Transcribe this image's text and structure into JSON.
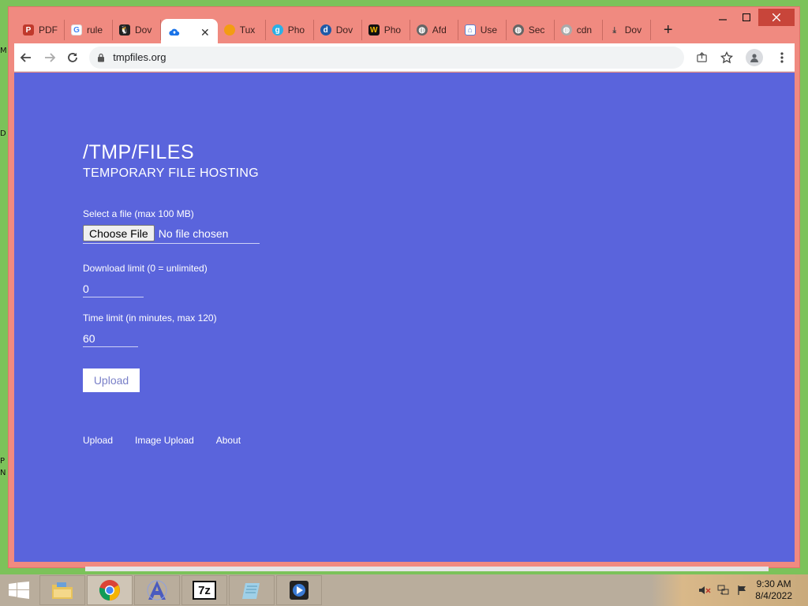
{
  "desktop": {
    "edge_letters": [
      "M",
      "D",
      "P",
      "N"
    ]
  },
  "browser": {
    "tabs": [
      {
        "label": "PDF",
        "icon": "pdf-icon",
        "color": "#c0392b"
      },
      {
        "label": "rule",
        "icon": "google-icon",
        "color": "#4285f4"
      },
      {
        "label": "Dov",
        "icon": "penguin-icon",
        "color": "#222222"
      },
      {
        "label": "",
        "icon": "cloud-upload-icon",
        "color": "#1a73e8",
        "active": true
      },
      {
        "label": "Tux",
        "icon": "orange-circle-icon",
        "color": "#f39c12"
      },
      {
        "label": "Pho",
        "icon": "g-badge-icon",
        "color": "#2bb0e6"
      },
      {
        "label": "Dov",
        "icon": "d-badge-icon",
        "color": "#1e5aa8"
      },
      {
        "label": "Pho",
        "icon": "w-badge-icon",
        "color": "#111111"
      },
      {
        "label": "Afd",
        "icon": "globe-icon",
        "color": "#555555"
      },
      {
        "label": "Use",
        "icon": "home-icon",
        "color": "#5a7fd1"
      },
      {
        "label": "Sec",
        "icon": "globe-icon",
        "color": "#555555"
      },
      {
        "label": "cdn",
        "icon": "globe-icon",
        "color": "#999999"
      },
      {
        "label": "Dov",
        "icon": "download-icon",
        "color": "#555555"
      }
    ],
    "new_tab_symbol": "+",
    "url": "tmpfiles.org"
  },
  "page": {
    "title": "/TMP/FILES",
    "subtitle": "TEMPORARY FILE HOSTING",
    "file_label": "Select a file (max 100 MB)",
    "choose_file_label": "Choose File",
    "file_status": "No file chosen",
    "download_limit_label": "Download limit (0 = unlimited)",
    "download_limit_value": "0",
    "time_limit_label": "Time limit (in minutes, max 120)",
    "time_limit_value": "60",
    "upload_button": "Upload",
    "footer": [
      "Upload",
      "Image Upload",
      "About"
    ],
    "background_color": "#5a64dc"
  },
  "taskbar": {
    "time": "9:30 AM",
    "date": "8/4/2022",
    "apps": [
      "file-explorer-icon",
      "chrome-icon",
      "app-a-icon",
      "7zip-icon",
      "notepad-icon",
      "media-icon"
    ],
    "sevenzip_label": "7z"
  }
}
